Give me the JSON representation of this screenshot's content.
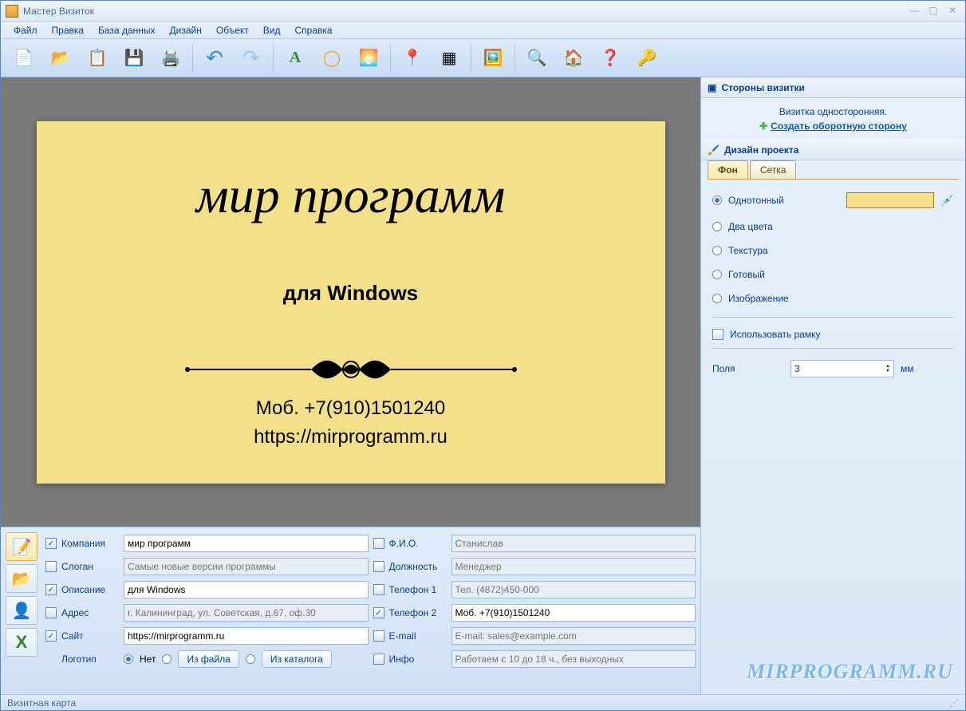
{
  "window": {
    "title": "Мастер Визиток"
  },
  "menu": {
    "file": "Файл",
    "edit": "Правка",
    "db": "База данных",
    "design": "Дизайн",
    "object": "Объект",
    "view": "Вид",
    "help": "Справка"
  },
  "toolbar_icons": {
    "new": "📄",
    "open": "📂",
    "clipboard": "📋",
    "save": "💾",
    "print": "🖨️",
    "undo": "↶",
    "redo": "↷",
    "text": "A",
    "shape": "◯",
    "image": "🌅",
    "map": "📍",
    "qr": "▦",
    "clipart": "🖼️",
    "preview": "🔍",
    "home": "🏠",
    "help": "❓",
    "key": "🔑"
  },
  "card": {
    "title": "мир программ",
    "desc": "для Windows",
    "phone": "Моб. +7(910)1501240",
    "site": "https://mirprogramm.ru"
  },
  "form": {
    "company_label": "Компания",
    "company_val": "мир программ",
    "slogan_label": "Слоган",
    "slogan_ph": "Самые новые версии программы",
    "desc_label": "Описание",
    "desc_val": "для Windows",
    "address_label": "Адрес",
    "address_ph": "г. Калининград, ул. Советская, д.67, оф.30",
    "site_label": "Сайт",
    "site_val": "https://mirprogramm.ru",
    "logo_label": "Логотип",
    "logo_no": "Нет",
    "logo_file": "Из файла",
    "logo_catalog": "Из каталога",
    "fio_label": "Ф.И.О.",
    "fio_ph": "Станислав",
    "position_label": "Должность",
    "position_ph": "Менеджер",
    "phone1_label": "Телефон 1",
    "phone1_ph": "Тел. (4872)450-000",
    "phone2_label": "Телефон 2",
    "phone2_val": "Моб. +7(910)1501240",
    "email_label": "E-mail",
    "email_ph": "E-mail: sales@example.com",
    "info_label": "Инфо",
    "info_ph": "Работаем с 10 до 18 ч., без выходных"
  },
  "right": {
    "sides_hdr": "Стороны визитки",
    "sided_info": "Визитка односторонняя.",
    "create_back": "Создать оборотную сторону",
    "design_hdr": "Дизайн проекта",
    "tab_bg": "Фон",
    "tab_grid": "Сетка",
    "opt_solid": "Однотонный",
    "opt_two": "Два цвета",
    "opt_tex": "Текстура",
    "opt_ready": "Готовый",
    "opt_img": "Изображение",
    "use_frame": "Использовать рамку",
    "margins_label": "Поля",
    "margins_val": "3",
    "mm": "мм"
  },
  "status": {
    "text": "Визитная карта"
  },
  "watermark": "MIRPROGRAMM.RU"
}
